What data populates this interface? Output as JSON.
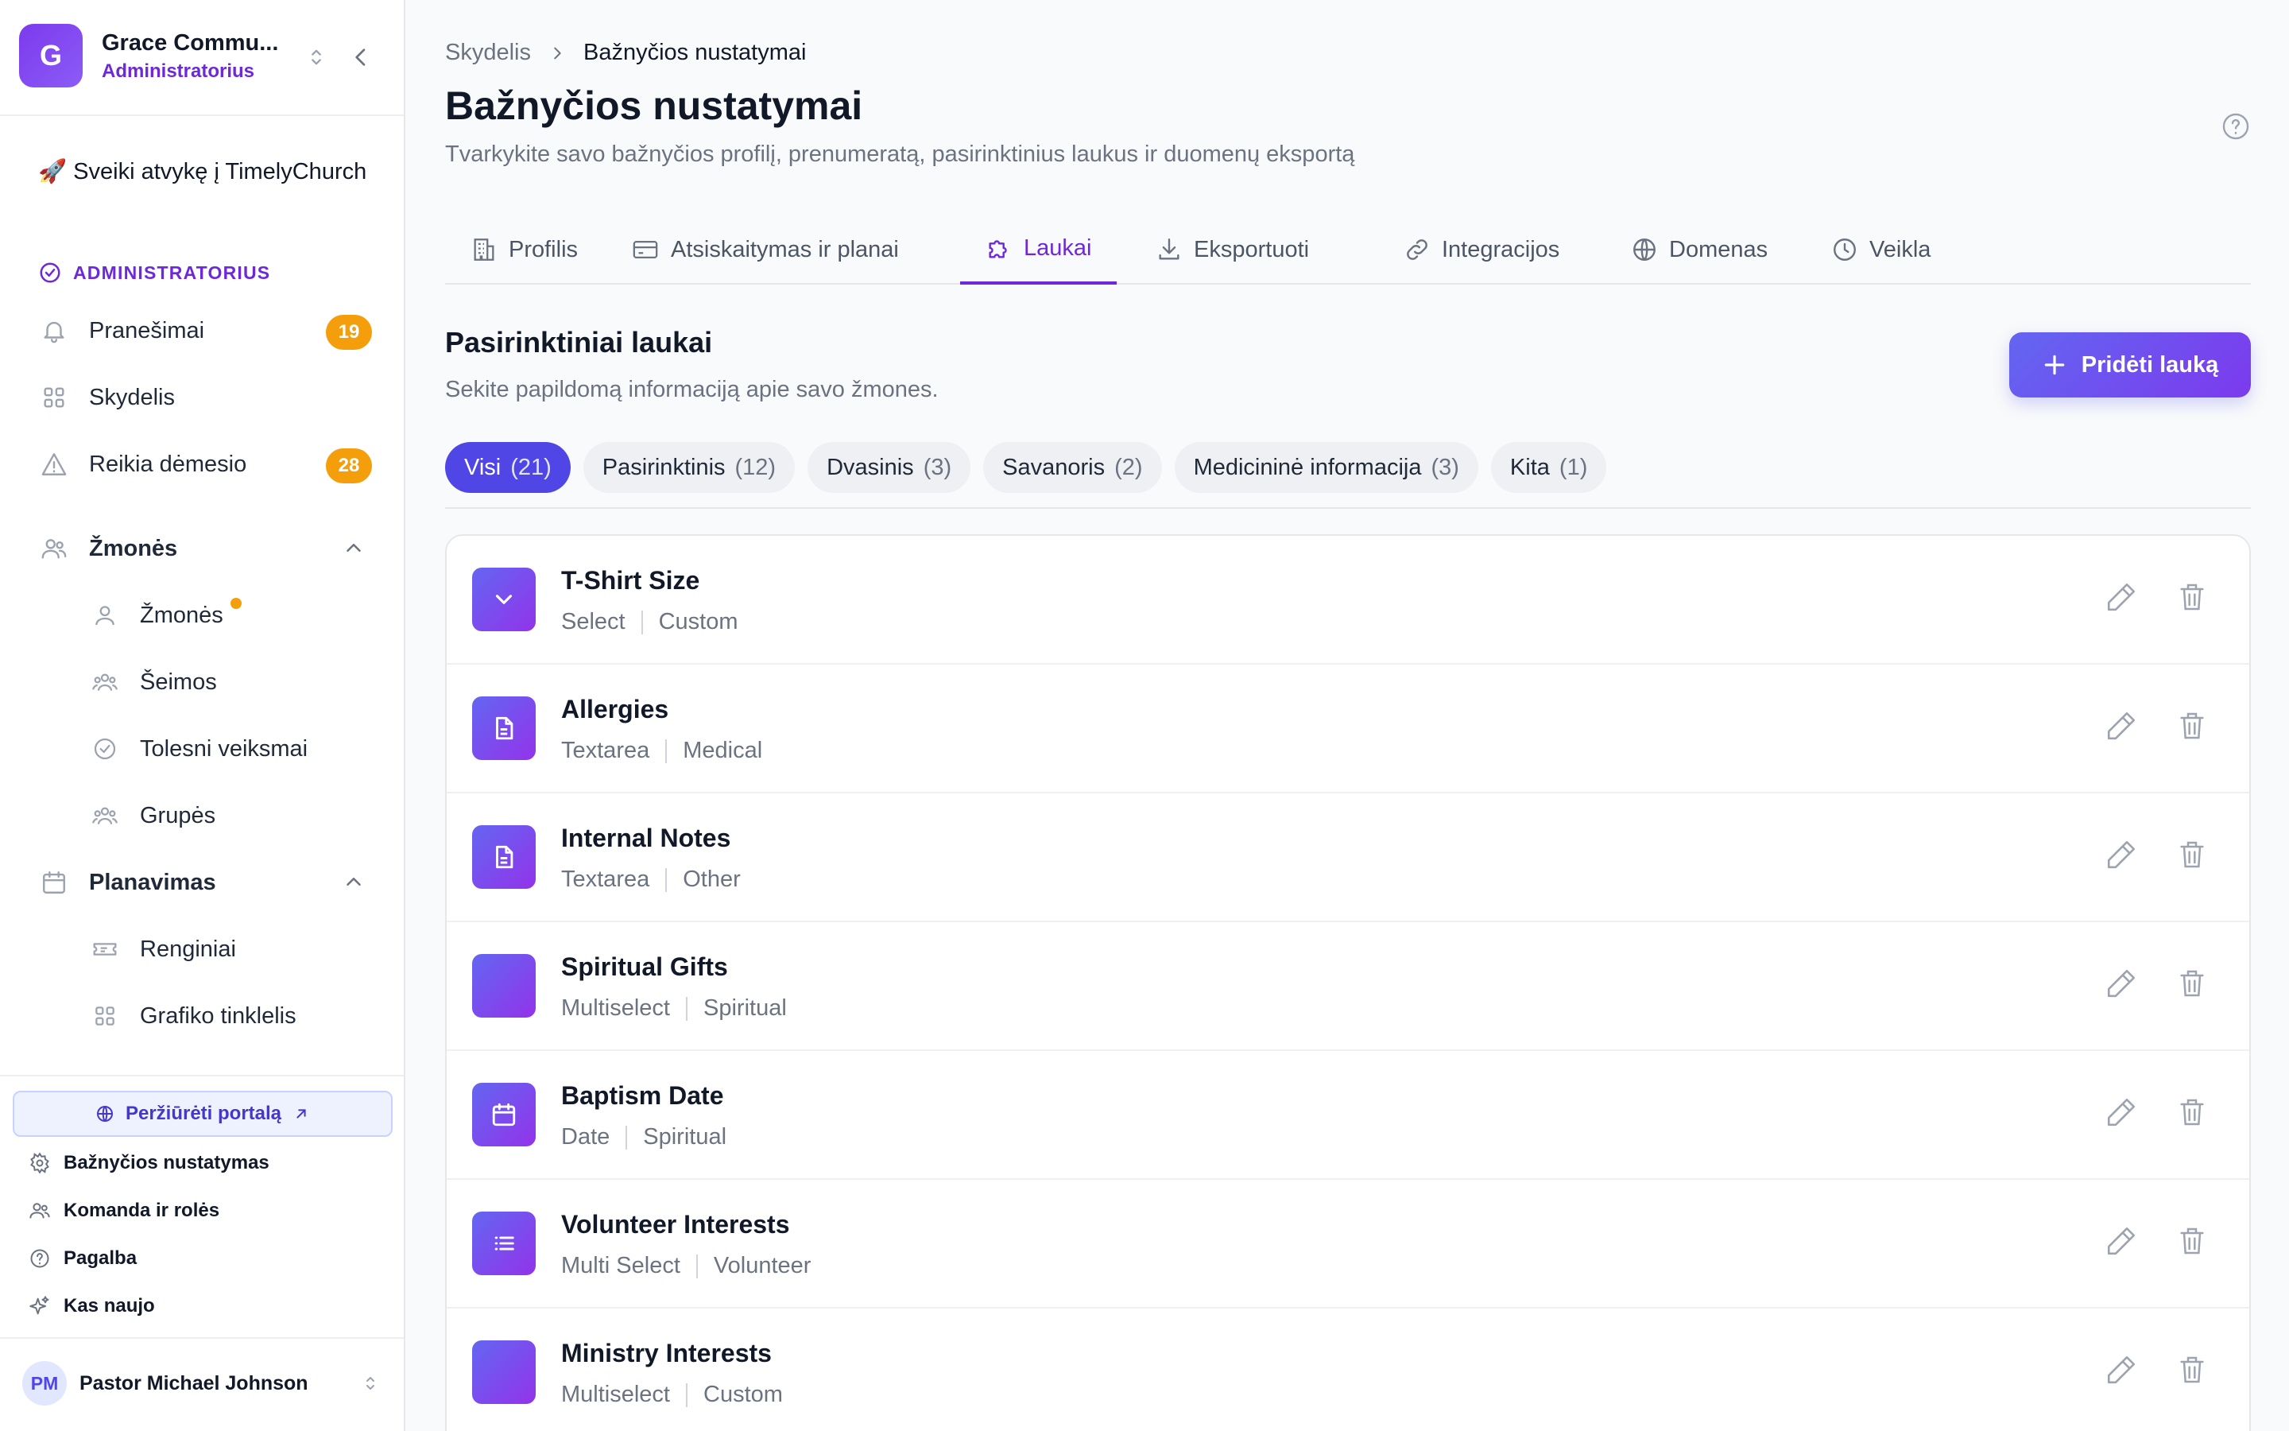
{
  "sidebar": {
    "org_initial": "G",
    "org_name": "Grace Commu...",
    "org_role": "Administratorius",
    "welcome": "Sveiki atvykę į TimelyChurch",
    "section_admin": "ADMINISTRATORIUS",
    "items": [
      {
        "label": "Pranešimai",
        "badge": "19",
        "icon": "bell-icon"
      },
      {
        "label": "Skydelis",
        "icon": "grid-icon"
      },
      {
        "label": "Reikia dėmesio",
        "badge": "28",
        "icon": "warning-icon"
      }
    ],
    "people_group": {
      "label": "Žmonės",
      "children": [
        {
          "label": "Žmonės",
          "icon": "user-icon"
        },
        {
          "label": "Šeimos",
          "icon": "users-icon"
        },
        {
          "label": "Tolesni veiksmai",
          "icon": "check-circle-icon"
        },
        {
          "label": "Grupės",
          "icon": "users-icon"
        }
      ]
    },
    "planning_group": {
      "label": "Planavimas",
      "children": [
        {
          "label": "Renginiai",
          "icon": "ticket-icon"
        },
        {
          "label": "Grafiko tinklelis",
          "icon": "grid-icon"
        }
      ]
    },
    "footer": {
      "portal_label": "Peržiūrėti portalą",
      "items": [
        {
          "label": "Bažnyčios nustatymas",
          "icon": "gear-icon"
        },
        {
          "label": "Komanda ir rolės",
          "icon": "users-icon"
        },
        {
          "label": "Pagalba",
          "icon": "help-icon"
        },
        {
          "label": "Kas naujo",
          "icon": "sparkles-icon"
        }
      ],
      "user_initials": "PM",
      "user_name": "Pastor Michael Johnson"
    }
  },
  "main": {
    "breadcrumb": {
      "root": "Skydelis",
      "current": "Bažnyčios nustatymai"
    },
    "title": "Bažnyčios nustatymai",
    "subtitle": "Tvarkykite savo bažnyčios profilį, prenumeratą, pasirinktinius laukus ir duomenų eksportą",
    "tabs": [
      {
        "label": "Profilis",
        "icon": "building-icon"
      },
      {
        "label": "Atsiskaitymas ir planai",
        "icon": "credit-card-icon"
      },
      {
        "label": "Laukai",
        "icon": "puzzle-icon",
        "active": true
      },
      {
        "label": "Eksportuoti",
        "icon": "download-icon"
      },
      {
        "label": "Integracijos",
        "icon": "link-icon"
      },
      {
        "label": "Domenas",
        "icon": "globe-icon"
      },
      {
        "label": "Veikla",
        "icon": "clock-icon"
      }
    ],
    "section_title": "Pasirinktiniai laukai",
    "section_subtitle": "Sekite papildomą informaciją apie savo žmones.",
    "add_button": "Pridėti lauką",
    "filters": [
      {
        "label": "Visi",
        "count": "(21)",
        "active": true
      },
      {
        "label": "Pasirinktinis",
        "count": "(12)"
      },
      {
        "label": "Dvasinis",
        "count": "(3)"
      },
      {
        "label": "Savanoris",
        "count": "(2)"
      },
      {
        "label": "Medicininė informacija",
        "count": "(3)"
      },
      {
        "label": "Kita",
        "count": "(1)"
      }
    ],
    "fields": [
      {
        "name": "T-Shirt Size",
        "type": "Select",
        "category": "Custom",
        "icon": "chevron-down-icon"
      },
      {
        "name": "Allergies",
        "type": "Textarea",
        "category": "Medical",
        "icon": "document-icon"
      },
      {
        "name": "Internal Notes",
        "type": "Textarea",
        "category": "Other",
        "icon": "document-icon"
      },
      {
        "name": "Spiritual Gifts",
        "type": "Multiselect",
        "category": "Spiritual",
        "icon": "blank-icon"
      },
      {
        "name": "Baptism Date",
        "type": "Date",
        "category": "Spiritual",
        "icon": "calendar-icon"
      },
      {
        "name": "Volunteer Interests",
        "type": "Multi Select",
        "category": "Volunteer",
        "icon": "list-icon"
      },
      {
        "name": "Ministry Interests",
        "type": "Multiselect",
        "category": "Custom",
        "icon": "blank-icon"
      }
    ]
  },
  "colors": {
    "accent": "#6d28d9",
    "accent_gradient_start": "#6366f1",
    "badge": "#f59e0b",
    "active_chip": "#4f46e5"
  }
}
